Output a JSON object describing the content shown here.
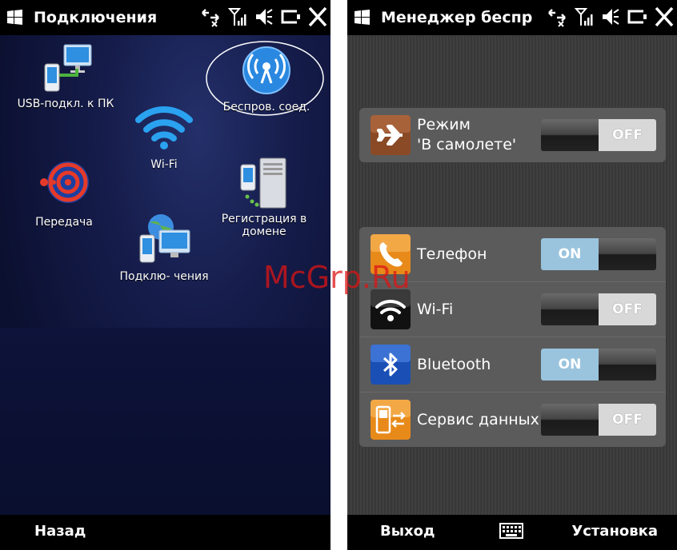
{
  "left_screen": {
    "title": "Подключения",
    "items": [
      {
        "label": "USB-подкл. к ПК",
        "icon": "usb-pc-icon"
      },
      {
        "label": "Wi-Fi",
        "icon": "wifi-icon"
      },
      {
        "label": "Беспров. соед.",
        "icon": "wireless-icon"
      },
      {
        "label": "Передача",
        "icon": "beam-icon"
      },
      {
        "label": "Регистрация в",
        "label2": "домене",
        "icon": "domain-server-icon"
      },
      {
        "label": "Подклю- чения",
        "icon": "connections-icon"
      }
    ],
    "softkey_left": "Назад"
  },
  "right_screen": {
    "title": "Менеджер беспр",
    "airplane": {
      "label": "Режим",
      "label2": "'В самолете'",
      "state": "OFF"
    },
    "rows": [
      {
        "label": "Телефон",
        "state": "ON",
        "icon": "phone-icon"
      },
      {
        "label": "Wi-Fi",
        "state": "OFF",
        "icon": "wifi-icon"
      },
      {
        "label": "Bluetooth",
        "state": "ON",
        "icon": "bluetooth-icon"
      },
      {
        "label": "Сервис данных",
        "state": "OFF",
        "icon": "data-service-icon"
      }
    ],
    "softkey_left": "Выход",
    "softkey_right": "Установка",
    "keyboard_icon": "keyboard-icon"
  },
  "watermark": "McGrp.Ru",
  "colors": {
    "on": "#9ac4de",
    "off": "#d8d8d8",
    "accent_blue": "#1a6fd8"
  }
}
